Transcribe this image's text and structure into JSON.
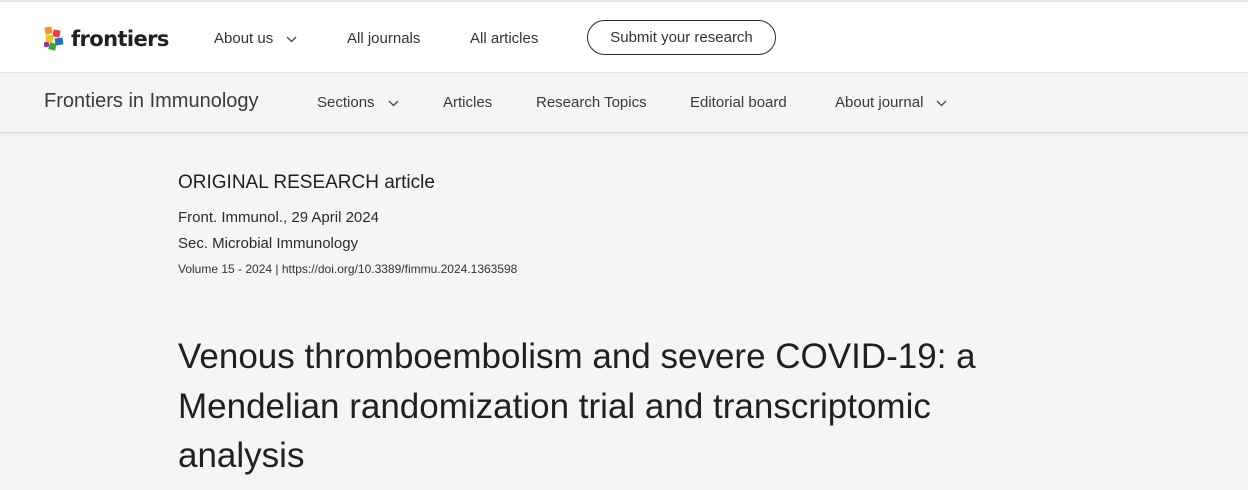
{
  "brand": {
    "name": "frontiers"
  },
  "top_nav": {
    "about_us": "About us",
    "all_journals": "All journals",
    "all_articles": "All articles",
    "submit": "Submit your research"
  },
  "journal_nav": {
    "journal_name": "Frontiers in Immunology",
    "sections": "Sections",
    "articles": "Articles",
    "research_topics": "Research Topics",
    "editorial_board": "Editorial board",
    "about_journal": "About journal"
  },
  "article": {
    "type": "ORIGINAL RESEARCH article",
    "citation": "Front. Immunol., 29 April 2024",
    "section": "Sec. Microbial Immunology",
    "volume_year": "Volume 15 - 2024 | ",
    "doi": "https://doi.org/10.3389/fimmu.2024.1363598",
    "title": "Venous thromboembolism and severe COVID-19: a Mendelian randomization trial and transcriptomic analysis"
  },
  "colors": {
    "page_bg": "#f5f5f5",
    "header_bg": "#ffffff",
    "text": "#202020",
    "logo_orange": "#f7941d",
    "logo_red": "#e5403b",
    "logo_blue": "#1e70c1",
    "logo_green": "#3aaa35",
    "logo_yellow": "#f6c416"
  },
  "icons": [
    "frontiers-logo-icon",
    "chevron-down-icon"
  ]
}
